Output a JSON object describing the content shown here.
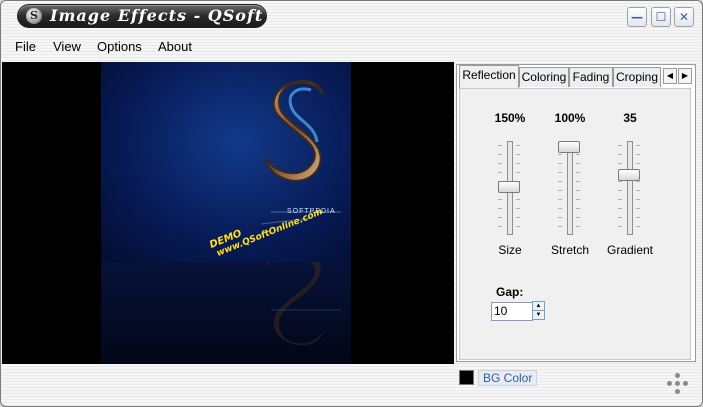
{
  "window": {
    "title": "Image Effects - QSoft",
    "minimize_glyph": "—",
    "maximize_glyph": "☐",
    "close_glyph": "✕"
  },
  "menu": {
    "items": [
      "File",
      "View",
      "Options",
      "About"
    ]
  },
  "preview": {
    "watermark_text": "SOFTPEDIA",
    "demo_label": "DEMO",
    "demo_url": "www.QSoftOnline.com"
  },
  "tabs": {
    "items": [
      "Reflection",
      "Coloring",
      "Fading",
      "Croping"
    ],
    "active": "Reflection",
    "scroll_left": "◀",
    "scroll_right": "▶"
  },
  "reflection": {
    "size": {
      "label": "Size",
      "value": "150%",
      "level": 0.5
    },
    "stretch": {
      "label": "Stretch",
      "value": "100%",
      "level": 0.0
    },
    "gradient": {
      "label": "Gradient",
      "value": "35",
      "level": 0.35
    },
    "gap": {
      "label": "Gap:",
      "value": "10"
    }
  },
  "status": {
    "bg_color_label": "BG Color",
    "bg_color": "#000000"
  },
  "icons": [
    "app-logo-icon",
    "minimize-icon",
    "maximize-icon",
    "close-icon",
    "spin-up-icon",
    "spin-down-icon",
    "resize-grip-icon"
  ]
}
